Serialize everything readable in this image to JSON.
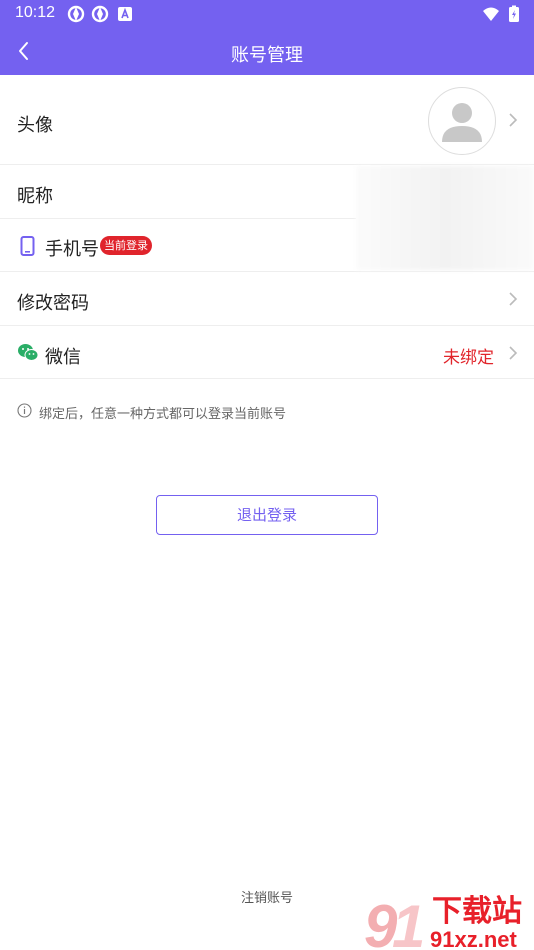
{
  "status_bar": {
    "time": "10:12"
  },
  "nav": {
    "title": "账号管理"
  },
  "rows": {
    "avatar": {
      "label": "头像"
    },
    "nickname": {
      "label": "昵称"
    },
    "phone": {
      "label": "手机号",
      "badge": "当前登录"
    },
    "password": {
      "label": "修改密码"
    },
    "wechat": {
      "label": "微信",
      "status": "未绑定"
    }
  },
  "hint": {
    "text": "绑定后，任意一种方式都可以登录当前账号"
  },
  "logout": {
    "label": "退出登录"
  },
  "cancel_account": {
    "label": "注销账号"
  },
  "watermark": {
    "brand": "下载站",
    "site": "91xz.net"
  },
  "colors": {
    "primary": "#7461F0",
    "danger": "#E1252B",
    "wechat_green": "#2AAE67"
  },
  "icons": [
    "back-arrow-icon",
    "chevron-right-icon",
    "phone-icon",
    "wechat-icon",
    "info-icon",
    "default-avatar-icon"
  ]
}
